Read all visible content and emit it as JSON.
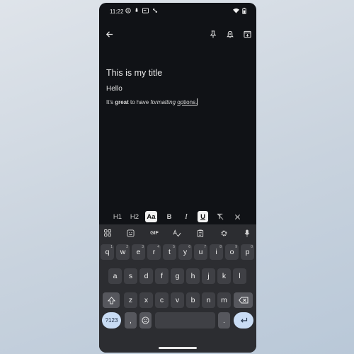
{
  "status_bar": {
    "time": "11:22"
  },
  "note": {
    "title": "This is my title",
    "line1": "Hello",
    "line2": {
      "part1": "It's ",
      "bold": "great",
      "part2": " to have ",
      "italic": "formatting",
      "part3": " ",
      "underlined": "options."
    }
  },
  "formatting_bar": {
    "h1": "H1",
    "h2": "H2",
    "normal_text": "Aa",
    "bold": "B",
    "italic": "I",
    "underline": "U",
    "active": "Aa"
  },
  "keyboard": {
    "toolbar": {
      "gif": "GIF"
    },
    "row1": [
      {
        "key": "q",
        "hint": "1"
      },
      {
        "key": "w",
        "hint": "2"
      },
      {
        "key": "e",
        "hint": "3"
      },
      {
        "key": "r",
        "hint": "4"
      },
      {
        "key": "t",
        "hint": "5"
      },
      {
        "key": "y",
        "hint": "6"
      },
      {
        "key": "u",
        "hint": "7"
      },
      {
        "key": "i",
        "hint": "8"
      },
      {
        "key": "o",
        "hint": "9"
      },
      {
        "key": "p",
        "hint": "0"
      }
    ],
    "row2": [
      "a",
      "s",
      "d",
      "f",
      "g",
      "h",
      "j",
      "k",
      "l"
    ],
    "row3": [
      "z",
      "x",
      "c",
      "v",
      "b",
      "n",
      "m"
    ],
    "symbols_key": "?123",
    "comma_key": ",",
    "period_key": "."
  },
  "icons": {
    "back": "arrow-left-icon",
    "pin": "pin-icon",
    "reminder": "bell-plus-icon",
    "archive": "archive-icon",
    "clear_format": "clear-format-icon",
    "close": "close-icon",
    "grid": "app-grid-icon",
    "sticker": "sticker-icon",
    "text_correction": "spellcheck-icon",
    "clipboard": "clipboard-icon",
    "settings": "gear-icon",
    "mic": "mic-icon",
    "shift": "shift-icon",
    "backspace": "backspace-icon",
    "emoji": "emoji-icon",
    "enter": "enter-icon"
  },
  "colors": {
    "background": "#101216",
    "keyboard": "#2c2d31",
    "key": "#3f4045",
    "accent_key": "#c9dcf4"
  }
}
